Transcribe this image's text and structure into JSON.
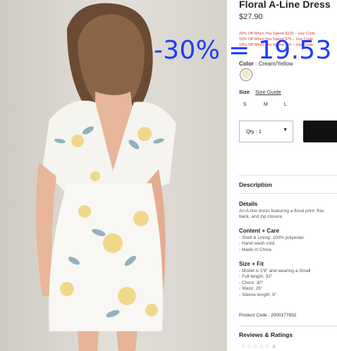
{
  "product": {
    "title": "Floral A-Line Dress",
    "price": "$27.90"
  },
  "promos": [
    "20% Off When You Spend $100 – Use Code",
    "15% Off When You Spend $75 – Use Code",
    "10% Off When You Spend $50 – Use Code"
  ],
  "color": {
    "label": "Color",
    "value": ": Cream/Yellow"
  },
  "size": {
    "label": "Size",
    "guide_link": "Size Guide",
    "options": [
      "S",
      "M",
      "L"
    ]
  },
  "quantity": {
    "label": "Qty : 1"
  },
  "description": {
    "heading": "Description",
    "details_heading": "Details",
    "details_lines": [
      "An A-line dress featuring a floral print, flou",
      "back, and zip closure."
    ],
    "content_heading": "Content + Care",
    "content_items": [
      "- Shell & Lining: 100% polyester",
      "- Hand wash cold",
      "- Made in China"
    ],
    "fit_heading": "Size + Fit",
    "fit_items": [
      "- Model is 5'9\" and wearing a Small",
      "- Full length: 33\"",
      "- Chest: 30\"",
      "- Waist: 26\"",
      "- Sleeve length: 9\""
    ],
    "product_code": "Product Code : 2000177932"
  },
  "reviews": {
    "heading": "Reviews & Ratings",
    "stars": "☆☆☆☆☆",
    "count": "0"
  },
  "overlay": {
    "text": "-30% = 19.53"
  },
  "colors": {
    "overlay_text": "#1d3bff",
    "promo_text": "#d23a3a",
    "add_to_bag": "#111111"
  }
}
